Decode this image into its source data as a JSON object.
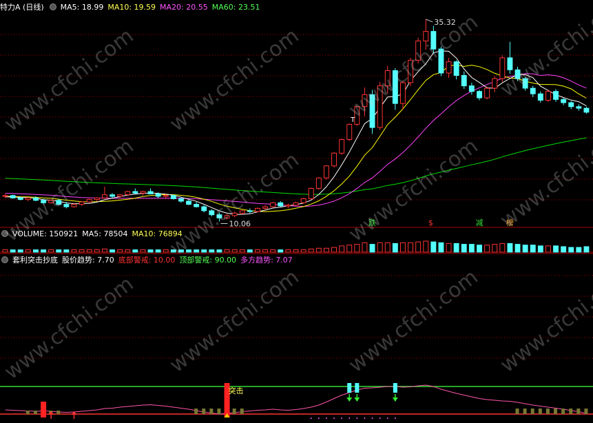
{
  "header_main": {
    "stock": "特力A (日线)",
    "ma": [
      {
        "label": "MA5: 18.99",
        "color": "#ffffff"
      },
      {
        "label": "MA10: 19.59",
        "color": "#ffff55"
      },
      {
        "label": "MA20: 20.55",
        "color": "#ff55ff"
      },
      {
        "label": "MA60: 23.51",
        "color": "#55ff55"
      }
    ]
  },
  "header_volume": {
    "items": [
      {
        "label": "VOLUME: 150921",
        "color": "#ffffff"
      },
      {
        "label": "MA5: 78504",
        "color": "#ffffff"
      },
      {
        "label": "MA10: 76894",
        "color": "#ffff55"
      }
    ]
  },
  "header_indicator": {
    "items": [
      {
        "label": "套利突击抄底",
        "color": "#ffffff"
      },
      {
        "label": "股价趋势: 7.70",
        "color": "#ffffff"
      },
      {
        "label": "底部警戒: 10.00",
        "color": "#ff3333"
      },
      {
        "label": "顶部警戒: 90.00",
        "color": "#55ff55"
      },
      {
        "label": "多方趋势: 7.07",
        "color": "#ff55ff"
      }
    ]
  },
  "annotations": {
    "high_label": "35.32",
    "low_label": "10.06",
    "tag_die": "跌",
    "tag_s": "$",
    "tag_jian": "减",
    "tag_bang": "榜",
    "tag_tuji": "突击",
    "tag_t": "T"
  },
  "watermark": "www.cfchi.com",
  "colors": {
    "up": "#ff3333",
    "down": "#54ffff",
    "grid": "#aa0000",
    "ma5": "#ffffff",
    "ma10": "#ffff00",
    "ma20": "#ff44ff",
    "ma60": "#00dd00"
  },
  "chart_data": {
    "type": "candlestick",
    "ylim": [
      9.5,
      36
    ],
    "y_high": 35.32,
    "y_low": 10.06,
    "candles": [
      [
        13.2,
        13.5,
        13.0,
        13.3
      ],
      [
        13.3,
        13.4,
        12.9,
        13.0
      ],
      [
        13.0,
        13.2,
        12.7,
        12.8
      ],
      [
        12.8,
        13.1,
        12.6,
        13.0
      ],
      [
        13.0,
        13.2,
        12.6,
        12.7
      ],
      [
        12.7,
        12.9,
        12.2,
        12.4
      ],
      [
        12.4,
        12.8,
        12.3,
        12.7
      ],
      [
        12.7,
        12.9,
        12.1,
        12.2
      ],
      [
        12.2,
        12.5,
        11.7,
        11.9
      ],
      [
        11.9,
        12.3,
        11.8,
        12.2
      ],
      [
        12.2,
        12.6,
        12.0,
        12.5
      ],
      [
        12.5,
        12.9,
        12.4,
        12.8
      ],
      [
        12.8,
        13.1,
        12.6,
        13.0
      ],
      [
        13.0,
        14.4,
        12.9,
        13.4
      ],
      [
        13.4,
        13.6,
        13.0,
        13.2
      ],
      [
        13.2,
        13.5,
        12.9,
        13.4
      ],
      [
        13.4,
        13.9,
        13.3,
        13.8
      ],
      [
        13.8,
        14.2,
        13.5,
        13.6
      ],
      [
        13.6,
        13.9,
        13.3,
        13.8
      ],
      [
        13.8,
        14.2,
        13.6,
        13.5
      ],
      [
        13.5,
        13.7,
        13.0,
        13.2
      ],
      [
        13.2,
        13.5,
        12.9,
        13.3
      ],
      [
        13.3,
        13.4,
        12.8,
        12.9
      ],
      [
        12.9,
        13.1,
        12.4,
        12.6
      ],
      [
        12.6,
        12.8,
        12.1,
        12.2
      ],
      [
        12.2,
        12.5,
        11.8,
        11.9
      ],
      [
        11.9,
        12.1,
        11.2,
        11.4
      ],
      [
        11.4,
        11.6,
        10.7,
        10.9
      ],
      [
        10.9,
        11.2,
        10.06,
        10.5
      ],
      [
        10.5,
        11.0,
        10.3,
        10.8
      ],
      [
        10.8,
        11.3,
        10.6,
        11.1
      ],
      [
        11.1,
        11.5,
        10.9,
        11.4
      ],
      [
        11.4,
        11.7,
        11.1,
        11.3
      ],
      [
        11.3,
        11.8,
        11.2,
        11.7
      ],
      [
        11.7,
        12.1,
        11.5,
        11.9
      ],
      [
        11.9,
        12.5,
        11.8,
        12.4
      ],
      [
        12.4,
        12.6,
        11.9,
        12.0
      ],
      [
        12.0,
        12.3,
        11.7,
        12.1
      ],
      [
        12.1,
        12.5,
        12.0,
        12.4
      ],
      [
        12.4,
        13.0,
        12.3,
        12.9
      ],
      [
        12.9,
        14.3,
        12.8,
        14.2
      ],
      [
        14.2,
        15.6,
        14.0,
        15.5
      ],
      [
        15.5,
        17.1,
        15.3,
        17.0
      ],
      [
        17.0,
        18.7,
        16.8,
        18.6
      ],
      [
        18.6,
        20.4,
        18.4,
        20.3
      ],
      [
        20.3,
        22.3,
        20.1,
        22.2
      ],
      [
        22.2,
        24.5,
        22.0,
        24.4
      ],
      [
        24.4,
        26.8,
        23.2,
        25.9
      ],
      [
        25.9,
        26.5,
        21.0,
        21.8
      ],
      [
        21.8,
        27.5,
        21.5,
        27.0
      ],
      [
        27.0,
        29.5,
        26.0,
        28.9
      ],
      [
        28.9,
        29.2,
        24.0,
        24.8
      ],
      [
        24.8,
        27.6,
        24.0,
        27.4
      ],
      [
        27.4,
        30.5,
        27.0,
        30.2
      ],
      [
        30.2,
        33.0,
        29.8,
        32.6
      ],
      [
        32.6,
        35.32,
        31.5,
        33.8
      ],
      [
        33.8,
        34.5,
        31.0,
        31.6
      ],
      [
        31.6,
        31.9,
        28.2,
        28.6
      ],
      [
        28.6,
        30.5,
        28.0,
        30.0
      ],
      [
        30.0,
        30.2,
        27.8,
        28.3
      ],
      [
        28.3,
        28.8,
        26.6,
        27.0
      ],
      [
        27.0,
        27.4,
        25.9,
        26.3
      ],
      [
        26.3,
        26.5,
        25.2,
        25.5
      ],
      [
        25.5,
        26.9,
        25.3,
        26.7
      ],
      [
        26.7,
        28.2,
        26.2,
        27.9
      ],
      [
        27.9,
        30.8,
        27.5,
        30.5
      ],
      [
        30.5,
        32.5,
        28.5,
        29.0
      ],
      [
        29.0,
        29.4,
        27.6,
        27.9
      ],
      [
        27.9,
        28.1,
        26.4,
        26.7
      ],
      [
        26.7,
        27.0,
        25.6,
        26.0
      ],
      [
        26.0,
        26.3,
        24.9,
        25.2
      ],
      [
        25.2,
        26.5,
        25.0,
        26.3
      ],
      [
        26.3,
        26.6,
        25.0,
        25.3
      ],
      [
        25.3,
        25.5,
        24.6,
        24.9
      ],
      [
        24.9,
        25.1,
        24.1,
        24.4
      ],
      [
        24.4,
        24.7,
        23.9,
        24.2
      ],
      [
        24.2,
        24.4,
        23.5,
        23.7
      ]
    ],
    "volume": [
      3,
      3,
      3,
      3,
      3,
      3,
      3,
      3,
      3,
      3,
      3,
      3,
      3,
      4,
      3,
      3,
      3,
      3,
      3,
      3,
      3,
      3,
      3,
      3,
      3,
      3,
      3,
      3,
      3,
      3,
      3,
      3,
      3,
      3,
      3,
      3,
      3,
      3,
      3,
      3,
      4,
      5,
      5,
      6,
      8,
      9,
      10,
      12,
      10,
      12,
      12,
      11,
      12,
      12,
      13,
      14,
      13,
      12,
      11,
      11,
      10,
      10,
      9,
      9,
      10,
      11,
      11,
      10,
      9,
      9,
      8,
      8,
      8,
      7,
      6,
      6,
      7
    ],
    "indicator": [
      22,
      21,
      20,
      19,
      18,
      19,
      18,
      16,
      15,
      16,
      18,
      20,
      22,
      26,
      27,
      30,
      32,
      34,
      36,
      37,
      35,
      33,
      30,
      27,
      24,
      20,
      16,
      13,
      10,
      12,
      14,
      17,
      19,
      21,
      22,
      24,
      22,
      21,
      23,
      26,
      30,
      36,
      45,
      55,
      65,
      72,
      80,
      85,
      86,
      88,
      90,
      90,
      88,
      89,
      92,
      94,
      90,
      82,
      76,
      70,
      65,
      60,
      55,
      52,
      50,
      48,
      47,
      44,
      40,
      36,
      33,
      30,
      27,
      24,
      20,
      17,
      12
    ]
  }
}
